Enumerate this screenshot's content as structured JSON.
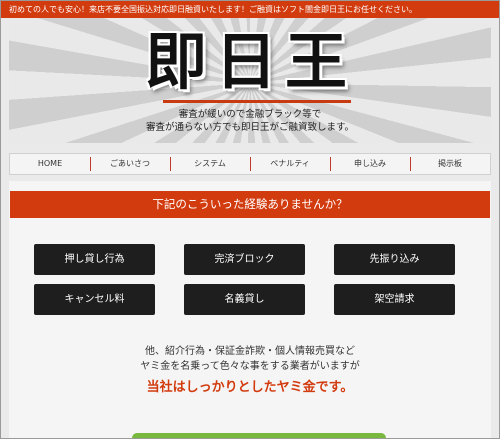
{
  "topbar": {
    "text": "初めての人でも安心！来店不要全国振込対応即日融資いたします！ご融資はソフト闇金即日王にお任せください。"
  },
  "hero": {
    "title": "即日王",
    "subtitle_line1": "審査が緩いので金融ブラック等で",
    "subtitle_line2": "審査が通らない方でも即日王がご融資致します。"
  },
  "nav": {
    "items": [
      {
        "label": "HOME"
      },
      {
        "label": "ごあいさつ"
      },
      {
        "label": "システム"
      },
      {
        "label": "ペナルティ"
      },
      {
        "label": "申し込み"
      },
      {
        "label": "掲示板"
      }
    ]
  },
  "main": {
    "banner": "下記のこういった経験ありませんか？",
    "experiences": [
      {
        "label": "押し貸し行為"
      },
      {
        "label": "完済ブロック"
      },
      {
        "label": "先振り込み"
      },
      {
        "label": "キャンセル料"
      },
      {
        "label": "名義貸し"
      },
      {
        "label": "架空請求"
      }
    ],
    "desc_line1": "他、紹介行為・保証金詐欺・個人情報売買など",
    "desc_line2": "ヤミ金を名乗って色々な事をする業者がいますが",
    "emphasis": "当社はしっかりとしたヤミ金です。"
  },
  "colors": {
    "accent": "#d23b0e",
    "button": "#1e1e1e",
    "cta": "#79b83f"
  }
}
